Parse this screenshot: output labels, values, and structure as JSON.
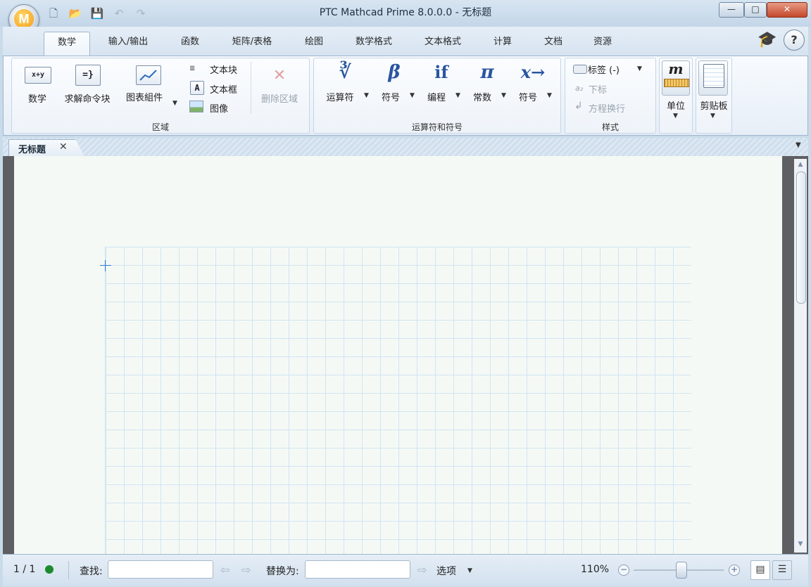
{
  "window": {
    "title": "PTC Mathcad Prime 8.0.0.0 - 无标题",
    "minimize_glyph": "—",
    "maximize_glyph": "□",
    "close_glyph": "✕"
  },
  "app_button": {
    "letter": "M"
  },
  "ribbon_tabs": [
    "数学",
    "输入/输出",
    "函数",
    "矩阵/表格",
    "绘图",
    "数学格式",
    "文本格式",
    "计算",
    "文档",
    "资源"
  ],
  "help_glyph": "?",
  "groups": {
    "regions": {
      "label": "区域",
      "math": {
        "label": "数学",
        "icon_text": "x+y"
      },
      "solve_block": {
        "label": "求解命令块",
        "icon_text": "=}"
      },
      "chart": {
        "label": "图表組件"
      },
      "text_block": "文本块",
      "text_box": "文本框",
      "image": "图像",
      "delete_region": "删除区域"
    },
    "operators": {
      "label": "运算符和符号",
      "operators_btn": {
        "label": "运算符",
        "symbol": "∛"
      },
      "symbols_btn": {
        "label": "符号",
        "symbol": "β"
      },
      "programming_btn": {
        "label": "编程",
        "symbol": "if"
      },
      "constants_btn": {
        "label": "常数",
        "symbol": "π"
      },
      "symbolics_btn": {
        "label": "符号",
        "symbol": "x→"
      }
    },
    "style": {
      "label": "样式",
      "tag": "标签 (-)",
      "subscript": "下标",
      "line_break": "方程换行"
    },
    "units": {
      "label": "单位",
      "symbol": "m"
    },
    "clipboard": {
      "label": "剪贴板"
    }
  },
  "document_tab": {
    "title": "无标题"
  },
  "statusbar": {
    "page": "1 / 1",
    "find_label": "查找:",
    "find_value": "",
    "replace_label": "替换为:",
    "replace_value": "",
    "options_label": "选项",
    "zoom": "110%"
  },
  "colors": {
    "accent": "#2a55a0",
    "status_ok": "#1d8a2f",
    "grid": "#d0e4f2"
  }
}
